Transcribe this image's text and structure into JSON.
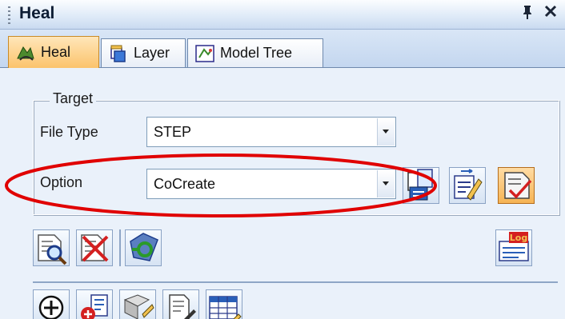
{
  "panel": {
    "title": "Heal",
    "pin_glyph": "p",
    "close_glyph": "✕"
  },
  "tabs": [
    {
      "label": "Heal",
      "icon": "heal-icon",
      "active": true
    },
    {
      "label": "Layer",
      "icon": "layer-icon",
      "active": false
    },
    {
      "label": "Model Tree",
      "icon": "model-tree-icon",
      "active": false
    }
  ],
  "target": {
    "legend": "Target",
    "file_type_label": "File Type",
    "file_type_value": "STEP",
    "option_label": "Option",
    "option_value": "CoCreate"
  },
  "colors": {
    "accent_active_tab": "#fbc36c",
    "highlight_ellipse": "#e00000",
    "panel_bg": "#eaf1fa"
  }
}
